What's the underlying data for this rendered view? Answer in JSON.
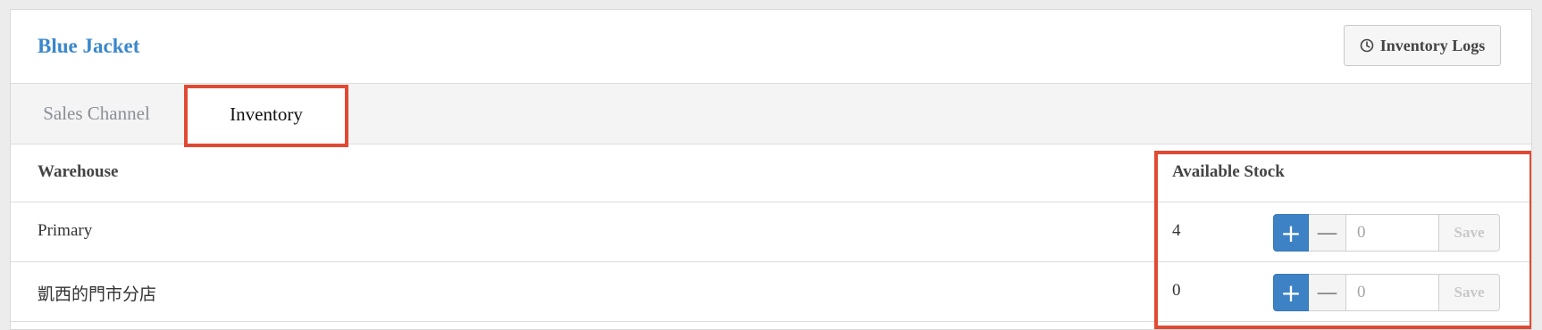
{
  "product": {
    "title": "Blue Jacket",
    "logs_button_label": "Inventory Logs"
  },
  "tabs": [
    {
      "label": "Sales Channel",
      "active": false
    },
    {
      "label": "Inventory",
      "active": true
    }
  ],
  "table": {
    "columns": [
      "Warehouse",
      "Available Stock"
    ],
    "rows": [
      {
        "warehouse": "Primary",
        "stock": "4",
        "plus": "+",
        "minus": "—",
        "qty_placeholder": "0",
        "save_label": "Save"
      },
      {
        "warehouse": "凱西的門市分店",
        "stock": "0",
        "plus": "+",
        "minus": "—",
        "qty_placeholder": "0",
        "save_label": "Save"
      }
    ]
  },
  "colors": {
    "accent": "#3a87cc",
    "primary_button": "#3e82c6",
    "highlight": "#e04a33"
  },
  "icons": {
    "logs_button": "clock-icon"
  }
}
